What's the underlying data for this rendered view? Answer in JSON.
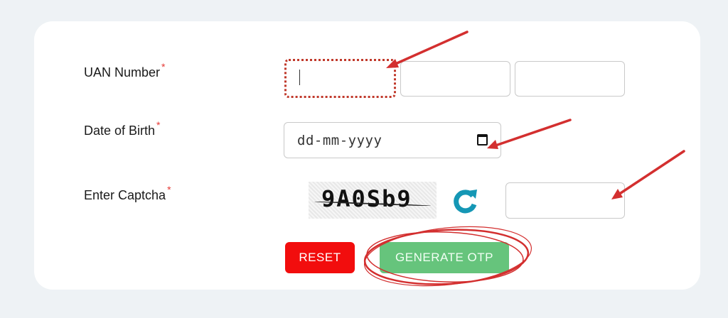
{
  "form": {
    "uan": {
      "label": "UAN Number",
      "required_mark": "*"
    },
    "dob": {
      "label": "Date of Birth",
      "required_mark": "*",
      "placeholder": "dd-mm-yyyy"
    },
    "captcha": {
      "label": "Enter Captcha",
      "required_mark": "*",
      "image_text": "9A0Sb9"
    },
    "buttons": {
      "reset_label": "RESET",
      "generate_label": "GENERATE OTP"
    }
  },
  "colors": {
    "page_bg": "#eef2f5",
    "required": "#e53935",
    "reset_button": "#f20d0d",
    "generate_button": "#66c47c",
    "annotation": "#d32f2f",
    "refresh_icon": "#1597b5"
  },
  "icons": [
    "calendar-icon",
    "refresh-icon"
  ]
}
